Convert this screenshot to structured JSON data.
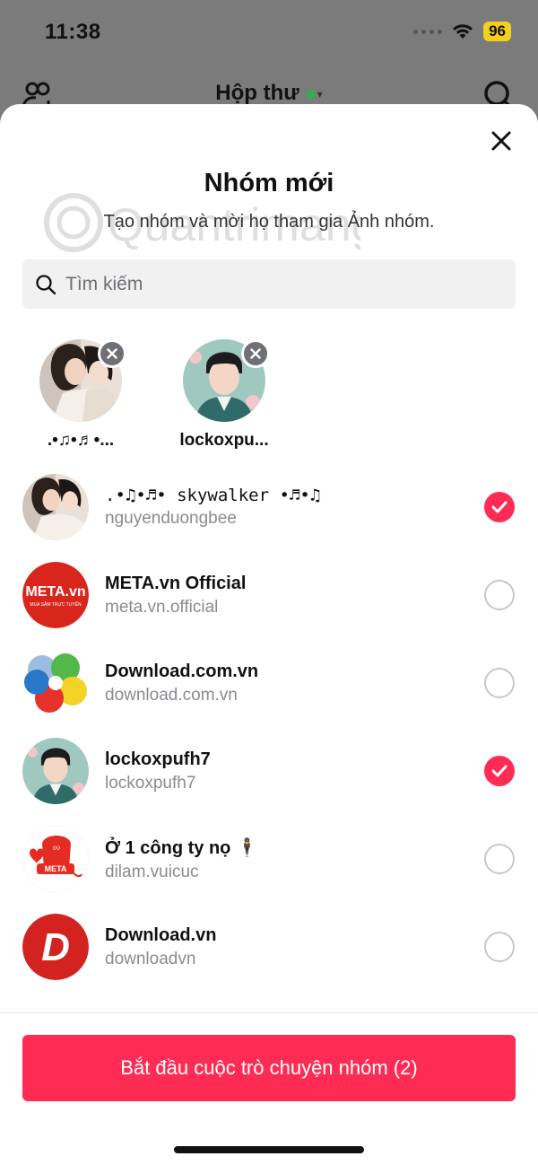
{
  "status_bar": {
    "time": "11:38",
    "battery": "96"
  },
  "background": {
    "title": "Hộp thư"
  },
  "sheet": {
    "title": "Nhóm mới",
    "subtitle": "Tạo nhóm và mời họ tham gia Ảnh nhóm.",
    "watermark": "Quantrimang"
  },
  "search": {
    "placeholder": "Tìm kiếm"
  },
  "selected": [
    {
      "name": ".•♫•♬•..."
    },
    {
      "name": "lockoxpu..."
    }
  ],
  "contacts": [
    {
      "display": ".•♫•♬• skywalker •♬•♫",
      "handle": "nguyenduongbee",
      "selected": true
    },
    {
      "display": "META.vn Official",
      "handle": "meta.vn.official",
      "selected": false
    },
    {
      "display": "Download.com.vn",
      "handle": "download.com.vn",
      "selected": false
    },
    {
      "display": "lockoxpufh7",
      "handle": "lockoxpufh7",
      "selected": true
    },
    {
      "display": "Ở 1 công ty nọ 🕴",
      "handle": "dilam.vuicuc",
      "selected": false
    },
    {
      "display": "Download.vn",
      "handle": "downloadvn",
      "selected": false
    }
  ],
  "logos": {
    "meta_text": "META.vn",
    "meta_sub": "MUA SẮM TRỰC TUYẾN",
    "meta_small": "META",
    "dl_letter": "D"
  },
  "cta": {
    "label": "Bắt đầu cuộc trò chuyện nhóm (2)"
  },
  "colors": {
    "accent": "#fe2c55",
    "meta_red": "#d9261c",
    "battery": "#f3d11b"
  }
}
